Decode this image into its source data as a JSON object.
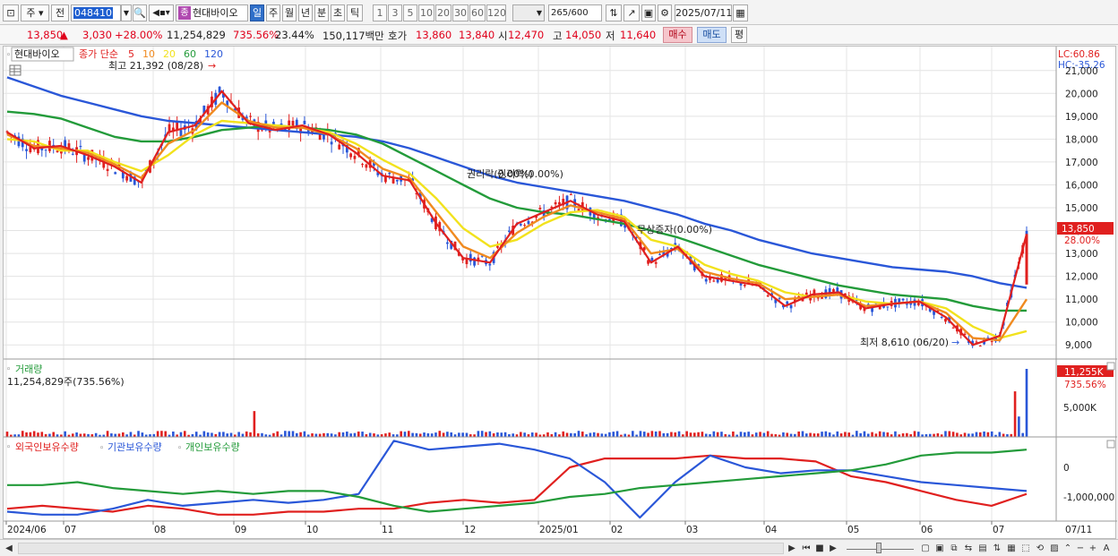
{
  "toolbar": {
    "market": "주",
    "prev": "전",
    "code": "048410",
    "stock_name": "현대바이오",
    "stock_badge": "종",
    "periods": [
      "일",
      "주",
      "월",
      "년",
      "분",
      "초",
      "틱"
    ],
    "intervals": [
      "1",
      "3",
      "5",
      "10",
      "20",
      "30",
      "60",
      "120"
    ],
    "count": "265",
    "count_max": "/600",
    "date": "2025/07/11"
  },
  "quote": {
    "price": "13,850",
    "change": "3,030",
    "change_pct": "+28.00%",
    "volume": "11,254,829",
    "volume_ratio": "735.56%",
    "turnover": "23.44%",
    "amount": "150,117백만",
    "bid_label": "호가",
    "ask": "13,860",
    "bid": "13,840",
    "open_label": "시",
    "open": "12,470",
    "high_label": "고",
    "high": "14,050",
    "low_label": "저",
    "low": "11,640",
    "buy_label": "매수",
    "sell_label": "매도",
    "eval_label": "평"
  },
  "chart": {
    "legend_name": "현대바이오",
    "legend_price_type": "종가 단순",
    "ma_labels": [
      "5",
      "10",
      "20",
      "60",
      "120"
    ],
    "ma_colors": [
      "#e0201f",
      "#f08a1f",
      "#f2e21d",
      "#239b3a",
      "#2a57d8"
    ],
    "lc_label": "LC:60.86",
    "hc_label": "HC:-35.26",
    "max_note": "최고 21,392 (08/28)",
    "min_note": "최저 8,610 (06/20)",
    "event1": "권리락(0.00%)",
    "event2": "권리락(0.00%)",
    "event3": "무상증자(0.00%)",
    "last_price_tag": "13,850",
    "last_pct_tag": "28.00%",
    "volume_title": "거래량",
    "volume_value": "11,254,829주(735.56%)",
    "volume_tag": "11,255K",
    "volume_pct_tag": "735.56%",
    "volume_axis": [
      "5,000K"
    ],
    "holdings": [
      "외국인보유수량",
      "기관보유수량",
      "개인보유수량"
    ],
    "holdings_axis": [
      "0",
      "-1,000,000"
    ],
    "x_labels": [
      "2024/06",
      "07",
      "08",
      "09",
      "10",
      "11",
      "12",
      "2025/01",
      "02",
      "03",
      "04",
      "05",
      "06",
      "07",
      "07/11"
    ]
  },
  "chart_data": {
    "type": "line",
    "y_axis": [
      "9,000",
      "10,000",
      "11,000",
      "12,000",
      "13,000",
      "14,000",
      "15,000",
      "16,000",
      "17,000",
      "18,000",
      "19,000",
      "20,000",
      "21,000"
    ],
    "ylim": [
      8500,
      21500
    ],
    "series": [
      {
        "name": "5",
        "values": [
          18300,
          17600,
          17700,
          17300,
          16800,
          16100,
          18300,
          18600,
          20100,
          18700,
          18400,
          18600,
          18200,
          17400,
          16400,
          16200,
          14300,
          12800,
          12600,
          14300,
          14800,
          15300,
          14700,
          14400,
          12600,
          13300,
          12000,
          11800,
          11600,
          10700,
          11200,
          11300,
          10600,
          10800,
          10900,
          10200,
          9000,
          9400,
          13850
        ]
      },
      {
        "name": "10",
        "values": [
          18200,
          17700,
          17600,
          17400,
          16900,
          16300,
          17800,
          18400,
          19600,
          18800,
          18500,
          18500,
          18200,
          17600,
          16700,
          16300,
          14800,
          13300,
          12800,
          13900,
          14600,
          15100,
          14800,
          14500,
          13000,
          13200,
          12200,
          11900,
          11700,
          11000,
          11100,
          11200,
          10700,
          10800,
          10900,
          10400,
          9300,
          9200,
          11000
        ]
      },
      {
        "name": "20",
        "values": [
          18000,
          17900,
          17500,
          17500,
          17000,
          16600,
          17300,
          18200,
          18800,
          18700,
          18600,
          18500,
          18300,
          17800,
          17100,
          16500,
          15400,
          14100,
          13300,
          13600,
          14300,
          14800,
          14900,
          14600,
          13600,
          13300,
          12500,
          12100,
          11800,
          11300,
          11100,
          11200,
          10900,
          10800,
          10900,
          10600,
          9800,
          9300,
          9600
        ]
      },
      {
        "name": "60",
        "values": [
          19200,
          19100,
          18900,
          18500,
          18100,
          17900,
          17900,
          18100,
          18400,
          18500,
          18600,
          18500,
          18400,
          18200,
          17800,
          17200,
          16600,
          16000,
          15400,
          15000,
          14800,
          14700,
          14500,
          14300,
          14000,
          13700,
          13300,
          12900,
          12500,
          12200,
          11900,
          11600,
          11400,
          11200,
          11100,
          11000,
          10700,
          10500,
          10500
        ]
      },
      {
        "name": "120",
        "values": [
          20700,
          20300,
          19900,
          19600,
          19300,
          19000,
          18800,
          18700,
          18600,
          18500,
          18400,
          18300,
          18200,
          18100,
          17900,
          17600,
          17200,
          16800,
          16400,
          16100,
          15900,
          15700,
          15500,
          15300,
          15000,
          14700,
          14300,
          14000,
          13600,
          13300,
          13000,
          12800,
          12600,
          12400,
          12300,
          12200,
          12000,
          11700,
          11500
        ]
      }
    ]
  }
}
